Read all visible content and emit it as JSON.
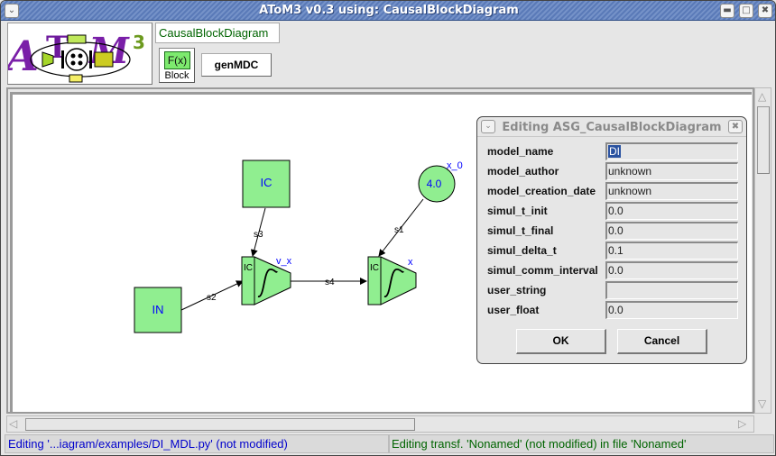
{
  "window": {
    "title": "AToM3 v0.3 using: CausalBlockDiagram",
    "menu_icon": "chevron-down-icon",
    "minimize_icon": "minimize-icon",
    "maximize_icon": "maximize-icon",
    "close_icon": "close-icon"
  },
  "toolbar": {
    "logo_text": "AToM3",
    "formalism_label": "CausalBlockDiagram",
    "block_button": {
      "icon_text": "F(x)",
      "label": "Block"
    },
    "gen_button_label": "genMDC"
  },
  "diagram": {
    "blocks": [
      {
        "id": "IN",
        "type": "square",
        "label": "IN"
      },
      {
        "id": "IC",
        "type": "square",
        "label": "IC"
      },
      {
        "id": "x_0",
        "type": "circle",
        "label": "4.0",
        "name": "x_0"
      },
      {
        "id": "v_x",
        "type": "integrator",
        "port_label": "IC",
        "name": "v_x"
      },
      {
        "id": "x",
        "type": "integrator",
        "port_label": "IC",
        "name": "x"
      }
    ],
    "connections": [
      {
        "label": "s2",
        "from": "IN",
        "to": "v_x"
      },
      {
        "label": "s3",
        "from": "IC",
        "to": "v_x.IC"
      },
      {
        "label": "s4",
        "from": "v_x",
        "to": "x"
      },
      {
        "label": "s1",
        "from": "x_0",
        "to": "x.IC"
      }
    ],
    "colors": {
      "block_fill": "#90ee90",
      "label_text": "#0000ff"
    }
  },
  "dialog": {
    "title": "Editing ASG_CausalBlockDiagram",
    "fields": [
      {
        "label": "model_name",
        "value": "DI",
        "selected": true
      },
      {
        "label": "model_author",
        "value": "unknown"
      },
      {
        "label": "model_creation_date",
        "value": "unknown"
      },
      {
        "label": "simul_t_init",
        "value": "0.0"
      },
      {
        "label": "simul_t_final",
        "value": "0.0"
      },
      {
        "label": "simul_delta_t",
        "value": "0.1"
      },
      {
        "label": "simul_comm_interval",
        "value": "0.0"
      },
      {
        "label": "user_string",
        "value": ""
      },
      {
        "label": "user_float",
        "value": "0.0"
      }
    ],
    "ok_label": "OK",
    "cancel_label": "Cancel"
  },
  "status": {
    "left": "Editing '...iagram/examples/DI_MDL.py' (not modified)",
    "right": "Editing transf. 'Nonamed' (not modified) in file 'Nonamed'"
  }
}
